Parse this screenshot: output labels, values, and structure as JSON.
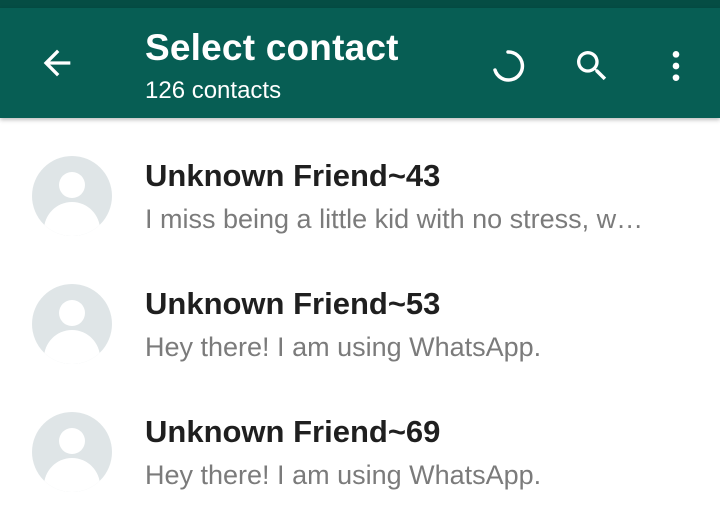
{
  "colors": {
    "header": "#075e54",
    "status_bar": "#054d44",
    "avatar_bg": "#dfe5e7"
  },
  "header": {
    "title": "Select contact",
    "subtitle": "126 contacts",
    "icons": [
      "back-arrow-icon",
      "refresh-icon",
      "search-icon",
      "more-vert-icon"
    ]
  },
  "contacts": [
    {
      "name": "Unknown Friend~43",
      "status": "I miss being a little kid with no stress, w…"
    },
    {
      "name": "Unknown Friend~53",
      "status": "Hey there! I am using WhatsApp."
    },
    {
      "name": "Unknown Friend~69",
      "status": "Hey there! I am using WhatsApp."
    }
  ]
}
